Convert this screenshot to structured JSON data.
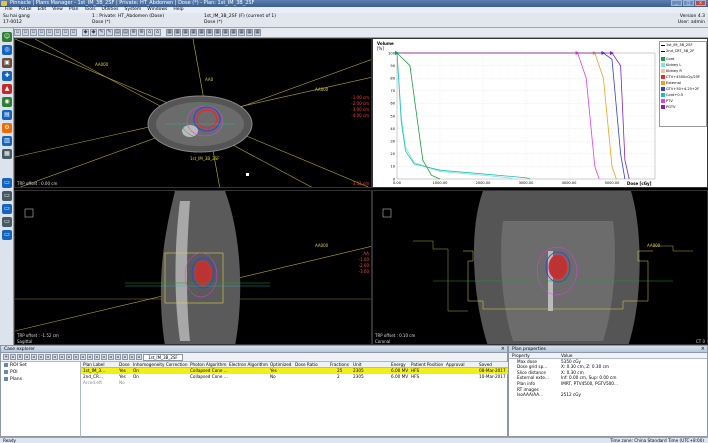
{
  "window": {
    "title": "Pinnacle | Plans Manager - 1st_IM_3B_2SF | Private: HT_Abdomen | Dose (*) - Plan: 1st_IM_3B_2SF",
    "version": "Version 4.3",
    "user_line": "User: admin",
    "controls": [
      "_",
      "□",
      "×"
    ]
  },
  "menu": [
    "File",
    "Portal",
    "Edit",
    "View",
    "Plan",
    "Tools",
    "Utilities",
    "System",
    "Windows",
    "Help"
  ],
  "patient": {
    "name": "Su hai gang",
    "id": "17-0012",
    "case_line": "1 : Private: HT_Abdomen (Dose)",
    "dose_line": "Dose (*)",
    "plan_line": "1st_IM_3B_2SF (F) (current of 1)",
    "plan_sub": "Dose (*)"
  },
  "views": {
    "axial": {
      "label_left": "AA000",
      "label_right": "AA000",
      "label_top": "AA0",
      "plan_tag": "1st_IM_3B_2SF",
      "bottom_left": "TRP offset : 0.00 cm",
      "bottom_right": "-3.32 cm",
      "iso_values": [
        "-1.00 cm",
        "-2.00 cm",
        "-3.00 cm",
        "-4.00 cm"
      ]
    },
    "sagittal": {
      "label_right": "AA000",
      "bottom_left": "TRP offset : -1.52 cm",
      "bottom_sub": "Sagittal",
      "iso_values": [
        "AA",
        "-1.00",
        "-2.00",
        "-3.00"
      ]
    },
    "coronal": {
      "label_right": "AA000",
      "bottom_left": "TRP offset : 0.10 cm",
      "bottom_sub": "Coronal",
      "corner": "CT 0"
    }
  },
  "dvh": {
    "ylabel": "Volume",
    "yunit": "[%]",
    "xlabel": "Dose [cGy]",
    "yticks": [
      "100",
      "90",
      "80",
      "70",
      "60",
      "50",
      "40",
      "30",
      "20",
      "10",
      "0"
    ],
    "xticks": [
      "0.00",
      "1000.00",
      "2000.00",
      "3000.00",
      "4000.00",
      "5000.00"
    ],
    "legend_top": [
      "1st_IM_3B_2SF",
      "2nd_CRT_3B_2F"
    ],
    "legend": [
      {
        "name": "Cord",
        "color": "#1a9e3a"
      },
      {
        "name": "Kidney L",
        "color": "#7de2e8"
      },
      {
        "name": "Kidney R",
        "color": "#f5c2a0"
      },
      {
        "name": "CTV+4500cGy/25F",
        "color": "#e8282e"
      },
      {
        "name": "External",
        "color": "#f0a020"
      },
      {
        "name": "GTV+50+4.25+2F",
        "color": "#3040d8"
      },
      {
        "name": "Cord+0.5",
        "color": "#20c0b0"
      },
      {
        "name": "PTV",
        "color": "#e040e0"
      },
      {
        "name": "PGTV",
        "color": "#8020c0"
      }
    ]
  },
  "chart_data": {
    "type": "line",
    "title": "",
    "xlabel": "Dose [cGy]",
    "ylabel": "Volume [%]",
    "xlim": [
      0,
      6000
    ],
    "ylim": [
      0,
      100
    ],
    "series": [
      {
        "name": "Kidney L",
        "x": [
          0,
          100,
          200,
          400,
          1000,
          2000,
          2600,
          2700
        ],
        "y": [
          100,
          50,
          25,
          13,
          6,
          3,
          1,
          0
        ]
      },
      {
        "name": "Cord+0.5",
        "x": [
          0,
          100,
          200,
          400,
          1000,
          2000,
          3000,
          3100
        ],
        "y": [
          100,
          45,
          22,
          12,
          7,
          4,
          1,
          0
        ]
      },
      {
        "name": "Cord",
        "x": [
          0,
          300,
          500,
          600,
          800,
          1000
        ],
        "y": [
          100,
          90,
          40,
          15,
          3,
          0
        ]
      },
      {
        "name": "GTV+50+4.25+2F",
        "x": [
          0,
          4800,
          5000,
          5200,
          5300
        ],
        "y": [
          100,
          100,
          95,
          20,
          0
        ]
      },
      {
        "name": "PTV",
        "x": [
          0,
          4200,
          4400,
          4600,
          4700
        ],
        "y": [
          100,
          100,
          80,
          10,
          0
        ]
      },
      {
        "name": "External",
        "x": [
          0,
          4600,
          4800,
          5000,
          5100
        ],
        "y": [
          100,
          100,
          80,
          10,
          0
        ]
      },
      {
        "name": "PGTV",
        "x": [
          0,
          5000,
          5200,
          5300,
          5400
        ],
        "y": [
          100,
          100,
          90,
          15,
          0
        ]
      }
    ]
  },
  "case_explorer": {
    "title": "Case explorer",
    "plan_selector": "1st_IM_3B_2SF",
    "tree": [
      "ROI Set",
      "POI",
      "Plans"
    ],
    "columns": [
      "Plan Label",
      "Dose",
      "Inhomogeneity Correction",
      "Photon Algorithm",
      "Electron Algorithm",
      "Optimized",
      "Dose Ratio",
      "Fractions",
      "Unit",
      "Energy",
      "Patient Position",
      "Approval",
      "Saved"
    ],
    "rows": [
      [
        "1st_IM_3...",
        "Yes",
        "On",
        "Collapsed Cone ...",
        "",
        "Yes",
        "",
        "25",
        "2305",
        "6.00 MV",
        "HFS",
        "",
        "08-Mar-2017 ..."
      ],
      [
        "2nd_CR...",
        "Yes",
        "On",
        "Collapsed Cone ...",
        "",
        "No",
        "",
        "2",
        "2305",
        "6.00 MV",
        "HFS",
        "",
        "10-Mar-2017 ..."
      ],
      [
        "Arced.eft",
        "No",
        "",
        "",
        "",
        "",
        "",
        "",
        "",
        "",
        "",
        "",
        ""
      ]
    ]
  },
  "plan_properties": {
    "title": "Plan properties",
    "columns": [
      "Property",
      "Value"
    ],
    "rows": [
      [
        "Max dose",
        "5350 cGy"
      ],
      [
        "Dose grid sp...",
        "X: 0.30 cm, Z: 0.30 cm"
      ],
      [
        "Slice distance",
        "X: 0.30 cm"
      ],
      [
        "External exte...",
        "Inf: 0.00 cm, Sup: 0.00 cm"
      ],
      [
        "Plan info",
        "IMRT, PTV4500, PGTV500..."
      ],
      [
        "RT images",
        ""
      ],
      [
        "IsoAAA/AA...",
        "2512 cGy"
      ]
    ]
  },
  "status": {
    "left": "Ready",
    "right": "Time zone: China Standard Time (UTC+8:00)"
  }
}
